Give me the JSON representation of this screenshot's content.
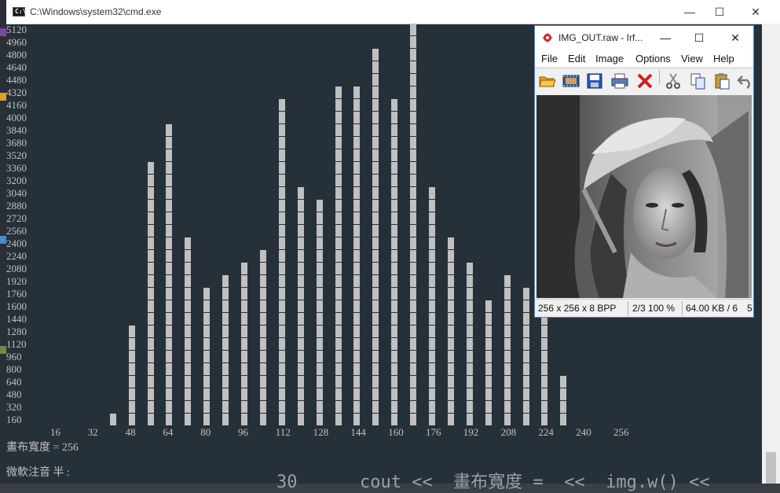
{
  "cmd": {
    "title": "C:\\Windows\\system32\\cmd.exe",
    "controls": {
      "minimize": "—",
      "maximize": "☐",
      "close": "✕"
    }
  },
  "histogram": {
    "y_labels": [
      "5120",
      "4960",
      "4800",
      "4640",
      "4480",
      "4320",
      "4160",
      "4000",
      "3840",
      "3680",
      "3520",
      "3360",
      "3200",
      "3040",
      "2880",
      "2720",
      "2560",
      "2400",
      "2240",
      "2080",
      "1920",
      "1760",
      "1600",
      "1440",
      "1280",
      "1120",
      "960",
      "800",
      "640",
      "480",
      "320",
      "160"
    ],
    "x_labels": [
      "16",
      "32",
      "48",
      "64",
      "80",
      "96",
      "112",
      "128",
      "144",
      "160",
      "176",
      "192",
      "208",
      "224",
      "240",
      "256"
    ]
  },
  "chart_data": {
    "type": "bar",
    "x": [
      40,
      48,
      56,
      64,
      72,
      80,
      88,
      96,
      104,
      112,
      120,
      128,
      136,
      144,
      152,
      160,
      168,
      176,
      184,
      192,
      200,
      208,
      216,
      224,
      232
    ],
    "values": [
      160,
      1280,
      3360,
      3840,
      2400,
      1760,
      1920,
      2080,
      2240,
      4160,
      3040,
      2880,
      4320,
      4320,
      4800,
      4160,
      5280,
      3040,
      2400,
      2080,
      1600,
      1920,
      1760,
      1600,
      640
    ],
    "y_unit_per_row": 160,
    "xlabel": "",
    "ylabel": "",
    "title": "",
    "xlim": [
      0,
      256
    ],
    "ylim": [
      160,
      5120
    ],
    "grid": false
  },
  "console": {
    "canvas_width_line": "畫布寬度 = 256",
    "ime_line": "微軟注音 半 :",
    "background_code": "30      cout <<  畫布寬度 =  <<  img.w() <<"
  },
  "irfanview": {
    "title": "IMG_OUT.raw - Irf...",
    "controls": {
      "minimize": "—",
      "maximize": "☐",
      "close": "✕"
    },
    "menu": [
      "File",
      "Edit",
      "Image",
      "Options",
      "View",
      "Help"
    ],
    "toolbar_icons": [
      "open-folder-icon",
      "slideshow-icon",
      "save-icon",
      "print-icon",
      "delete-icon",
      "cut-icon",
      "copy-icon",
      "paste-icon",
      "undo-icon"
    ],
    "status": {
      "dimensions": "256 x 256 x 8 BPP",
      "index_zoom": "2/3  100 %",
      "size": "64.00 KB / 6",
      "overflow": "5"
    },
    "image_alt": "grayscale portrait of a woman wearing a wide-brimmed hat"
  }
}
